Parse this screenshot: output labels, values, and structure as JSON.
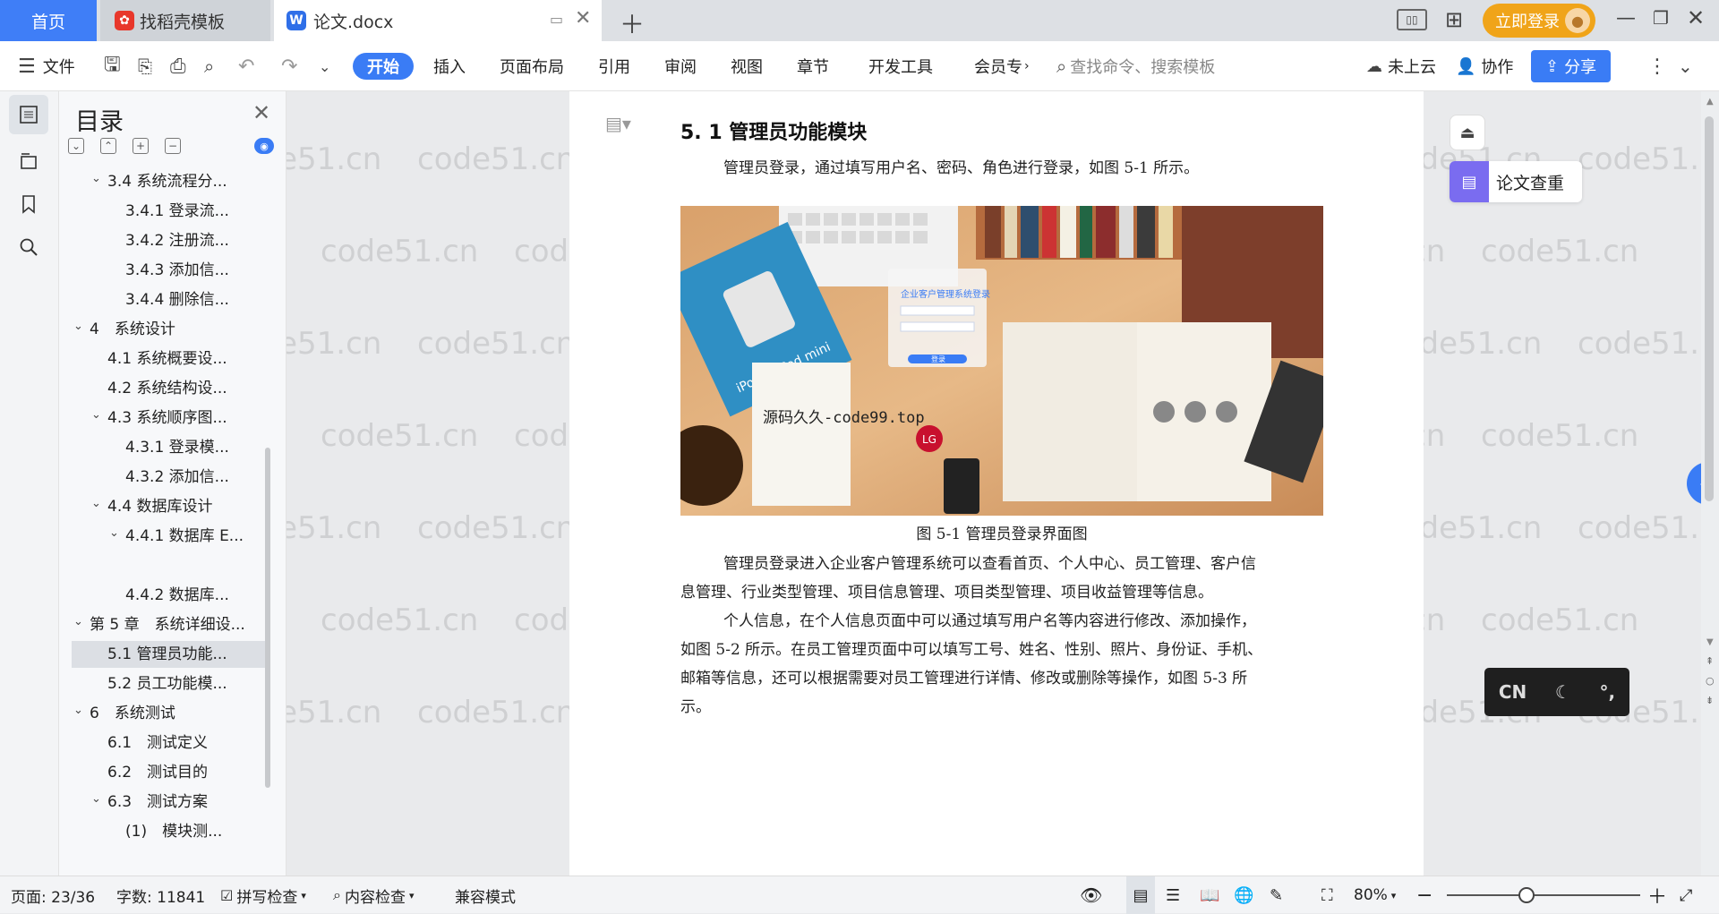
{
  "tabs": {
    "home": "首页",
    "template": "找稻壳模板",
    "doc": "论文.docx",
    "login": "立即登录"
  },
  "toolbar": {
    "file": "文件",
    "start": "开始",
    "insert": "插入",
    "layout": "页面布局",
    "reference": "引用",
    "review": "审阅",
    "view": "视图",
    "chapter": "章节",
    "devtools": "开发工具",
    "member": "会员专",
    "search_placeholder": "查找命令、搜索模板",
    "cloud": "未上云",
    "collab": "协作",
    "share": "分享"
  },
  "toc": {
    "title": "目录",
    "items": [
      {
        "label": "3.4 系统流程分...",
        "level": 1,
        "expanded": true
      },
      {
        "label": "3.4.1 登录流...",
        "level": 2
      },
      {
        "label": "3.4.2 注册流...",
        "level": 2
      },
      {
        "label": "3.4.3 添加信...",
        "level": 2
      },
      {
        "label": "3.4.4 删除信...",
        "level": 2
      },
      {
        "label": "4　系统设计",
        "level": 0,
        "expanded": true
      },
      {
        "label": "4.1 系统概要设...",
        "level": 1
      },
      {
        "label": "4.2 系统结构设...",
        "level": 1
      },
      {
        "label": "4.3 系统顺序图...",
        "level": 1,
        "expanded": true
      },
      {
        "label": "4.3.1 登录模...",
        "level": 2
      },
      {
        "label": "4.3.2 添加信...",
        "level": 2
      },
      {
        "label": "4.4 数据库设计",
        "level": 1,
        "expanded": true
      },
      {
        "label": "4.4.1 数据库 E...",
        "level": 2,
        "expanded": true
      },
      {
        "label": "",
        "level": 2
      },
      {
        "label": "4.4.2 数据库...",
        "level": 2
      },
      {
        "label": "第 5 章　系统详细设...",
        "level": 0,
        "expanded": true
      },
      {
        "label": "5.1 管理员功能...",
        "level": 1,
        "selected": true
      },
      {
        "label": "5.2 员工功能模...",
        "level": 1
      },
      {
        "label": "6　系统测试",
        "level": 0,
        "expanded": true
      },
      {
        "label": "6.1　测试定义",
        "level": 1
      },
      {
        "label": "6.2　测试目的",
        "level": 1
      },
      {
        "label": "6.3　测试方案",
        "level": 1,
        "expanded": true
      },
      {
        "label": "(1)　模块测...",
        "level": 2
      }
    ]
  },
  "document": {
    "heading": "5. 1 管理员功能模块",
    "para1": "管理员登录，通过填写用户名、密码、角色进行登录，如图 5-1 所示。",
    "figure_overlay": "源码久久-code99.top",
    "figure_app_title": "企业客户管理系统登录",
    "figure_login_btn": "登录",
    "figure_book_text": "iPod + iPod mini",
    "caption": "图 5-1 管理员登录界面图",
    "para2_line1": "管理员登录进入企业客户管理系统可以查看首页、个人中心、员工管理、客户信",
    "para2_line2": "息管理、行业类型管理、项目信息管理、项目类型管理、项目收益管理等信息。",
    "para3_line1": "个人信息，在个人信息页面中可以通过填写用户名等内容进行修改、添加操作，",
    "para3_line2": "如图 5-2 所示。在员工管理页面中可以填写工号、姓名、性别、照片、身份证、手机、",
    "para3_line3": "邮箱等信息，还可以根据需要对员工管理进行详情、修改或删除等操作，如图 5-3 所",
    "para3_line4": "示。"
  },
  "watermark": "code51.cn",
  "side": {
    "check": "论文查重"
  },
  "ime": {
    "lang": "CN"
  },
  "status": {
    "page": "页面: 23/36",
    "words": "字数: 11841",
    "spell": "拼写检查",
    "content": "内容检查",
    "compat": "兼容模式",
    "zoom": "80%"
  },
  "colors": {
    "accent": "#3a7cf5",
    "login": "#f0a419"
  }
}
